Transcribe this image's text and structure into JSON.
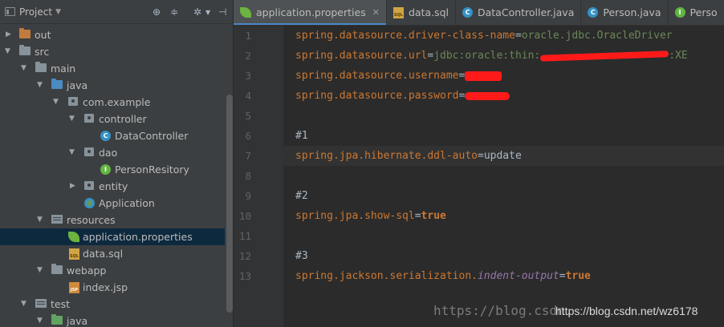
{
  "project_panel": {
    "title": "Project",
    "tree": [
      {
        "label": "out",
        "expanded": false,
        "icon": "folder-orange-icon"
      },
      {
        "label": "src",
        "expanded": true,
        "icon": "folder-icon"
      },
      {
        "label": "main",
        "expanded": true,
        "icon": "folder-icon"
      },
      {
        "label": "java",
        "expanded": true,
        "icon": "folder-blue-icon"
      },
      {
        "label": "com.example",
        "expanded": true,
        "icon": "package-icon"
      },
      {
        "label": "controller",
        "expanded": true,
        "icon": "package-icon"
      },
      {
        "label": "DataController",
        "icon": "class-icon"
      },
      {
        "label": "dao",
        "expanded": true,
        "icon": "package-icon"
      },
      {
        "label": "PersonResitory",
        "icon": "interface-icon"
      },
      {
        "label": "entity",
        "expanded": false,
        "icon": "package-icon"
      },
      {
        "label": "Application",
        "icon": "spring-boot-app-icon"
      },
      {
        "label": "resources",
        "expanded": true,
        "icon": "resources-folder-icon"
      },
      {
        "label": "application.properties",
        "icon": "spring-properties-icon",
        "selected": true
      },
      {
        "label": "data.sql",
        "icon": "sql-file-icon"
      },
      {
        "label": "webapp",
        "expanded": true,
        "icon": "folder-icon"
      },
      {
        "label": "index.jsp",
        "icon": "jsp-file-icon"
      },
      {
        "label": "test",
        "expanded": true,
        "icon": "folder-icon"
      },
      {
        "label": "java",
        "expanded": true,
        "icon": "folder-green-icon"
      }
    ]
  },
  "tabs": [
    {
      "label": "application.properties",
      "icon": "spring-properties-icon",
      "active": true,
      "closable": true
    },
    {
      "label": "data.sql",
      "icon": "sql-file-icon"
    },
    {
      "label": "DataController.java",
      "icon": "class-icon"
    },
    {
      "label": "Person.java",
      "icon": "class-icon"
    },
    {
      "label": "Perso",
      "icon": "interface-icon"
    }
  ],
  "icon_glyphs": {
    "class": "C",
    "interface": "I",
    "sql": "SQL",
    "jsp": "JSP"
  },
  "editor": {
    "line_numbers": [
      "1",
      "2",
      "3",
      "4",
      "5",
      "6",
      "7",
      "8",
      "9",
      "10",
      "11",
      "12",
      "13"
    ],
    "current_line": 7,
    "lines": {
      "l1": {
        "key": "spring.datasource.driver-class-name",
        "eq": "=",
        "value": "oracle.jdbc.OracleDriver"
      },
      "l2": {
        "key": "spring.datasource.url",
        "eq": "=",
        "value_prefix": "jdbc:oracle:thin:",
        "value_suffix": ":XE"
      },
      "l3": {
        "key": "spring.datasource.username",
        "eq": "="
      },
      "l4": {
        "key": "spring.datasource.password",
        "eq": "="
      },
      "l6": {
        "comment": "#1"
      },
      "l7": {
        "key": "spring.jpa.hibernate.ddl-auto",
        "eq": "=",
        "value": "update"
      },
      "l9": {
        "comment": "#2"
      },
      "l10": {
        "key": "spring.jpa.show-sql",
        "eq": "=",
        "value": "true"
      },
      "l12": {
        "comment": "#3"
      },
      "l13": {
        "key_prefix": "spring.jackson.serialization.",
        "key_italic": "indent-output",
        "eq": "=",
        "value": "true"
      }
    }
  },
  "watermarks": {
    "faint": "https://blog.csdn.",
    "overlay": "https://blog.csdn.net/wz6178"
  },
  "colors": {
    "key": "#cc7832",
    "value": "#6a8759",
    "accent": "#4a88c7",
    "redaction": "#ff1a1a"
  }
}
